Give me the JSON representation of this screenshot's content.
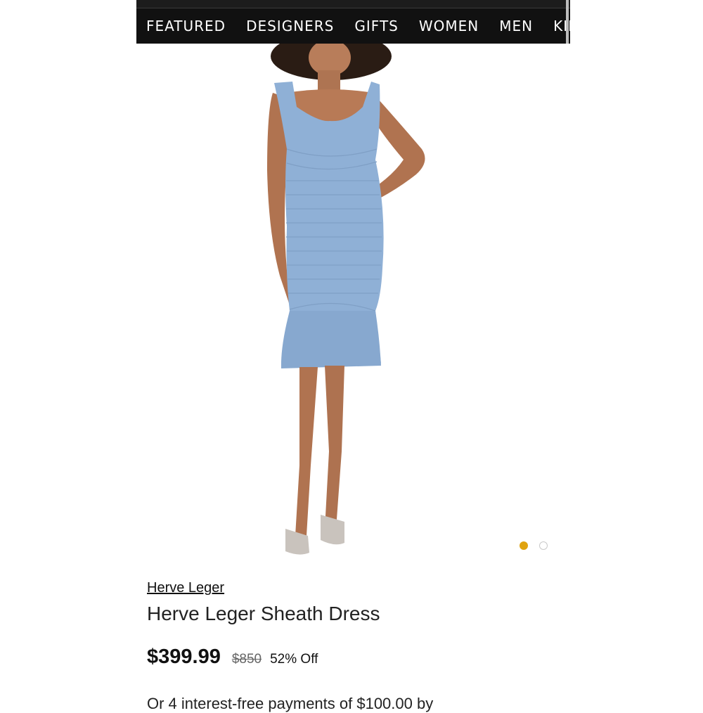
{
  "nav": {
    "items": [
      "FEATURED",
      "DESIGNERS",
      "GIFTS",
      "WOMEN",
      "MEN",
      "KIDS"
    ]
  },
  "product": {
    "brand": "Herve Leger",
    "title": "Herve Leger Sheath Dress",
    "image_alt": "Model wearing light blue bandage sheath dress with flounce hem",
    "carousel": {
      "count": 2,
      "active": 1
    }
  },
  "pricing": {
    "sale": "$399.99",
    "original": "$850",
    "discount": "52% Off"
  },
  "partial_line": "Or 4 interest-free payments of $100.00 by",
  "colors": {
    "nav_bg": "#111111",
    "dress": "#8fb0d6",
    "dot_active": "#e0a310",
    "dot_inactive": "#c9c9c9"
  }
}
